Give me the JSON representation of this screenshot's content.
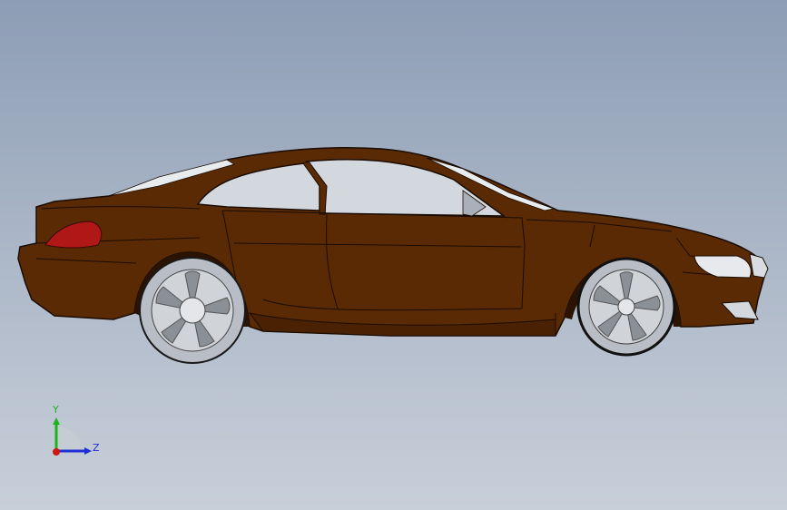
{
  "viewport": {
    "background_top": "#8d9db5",
    "background_bottom": "#c8cfd9"
  },
  "model": {
    "body_color": "#5a2a04",
    "body_edge_color": "#1a0c02",
    "glass_color": "#d3d8df",
    "taillight_color": "#b01818",
    "wheel_rim_color": "#d0d3d8",
    "tire_color": "#b9bec6"
  },
  "triad": {
    "y_label": "Y",
    "z_label": "Z",
    "y_color": "#1db31d",
    "z_color": "#1f2fd6",
    "x_color": "#d01515"
  }
}
